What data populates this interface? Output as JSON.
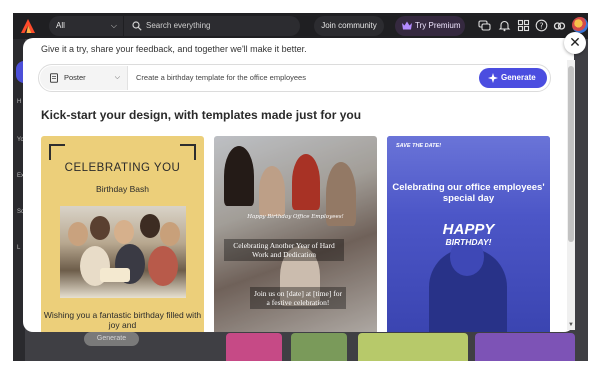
{
  "colors": {
    "accent": "#4b4de0",
    "topbar_bg": "#1f1f22",
    "premium_bg": "#35293f",
    "card1_bg": "#eccf7a",
    "card3_bg": "#4a55c8"
  },
  "topbar": {
    "scope_value": "All",
    "search_placeholder": "Search everything",
    "join_label": "Join community",
    "premium_label": "Try Premium",
    "icons": [
      "logo-icon",
      "search-icon",
      "crown-icon",
      "chat-icon",
      "bell-icon",
      "grid-apps-icon",
      "help-icon",
      "creative-cloud-icon"
    ]
  },
  "sidebar": {
    "fragments": [
      "H",
      "Yo",
      "Ex",
      "Sch",
      "L"
    ]
  },
  "background": {
    "generate_label": "Generate"
  },
  "modal": {
    "intro": "Give it a try, share your feedback, and together we'll make it better.",
    "format_value": "Poster",
    "prompt_value": "Create a birthday template for the office employees",
    "generate_label": "Generate",
    "heading": "Kick-start your design, with templates made just for you",
    "close_icon": "close-icon"
  },
  "templates": [
    {
      "title": "CELEBRATING YOU",
      "subtitle": "Birthday Bash",
      "body": "Wishing you a fantastic birthday filled with joy and"
    },
    {
      "tagline": "Happy Birthday Office Employees!",
      "box1": "Celebrating Another Year of Hard Work and Dedication",
      "box2": "Join us on [date] at [time] for a festive celebration!"
    },
    {
      "badge": "SAVE THE DATE!",
      "title": "Celebrating our office employees' special day",
      "happy": "HAPPY",
      "birthday": "BIRTHDAY!"
    }
  ]
}
